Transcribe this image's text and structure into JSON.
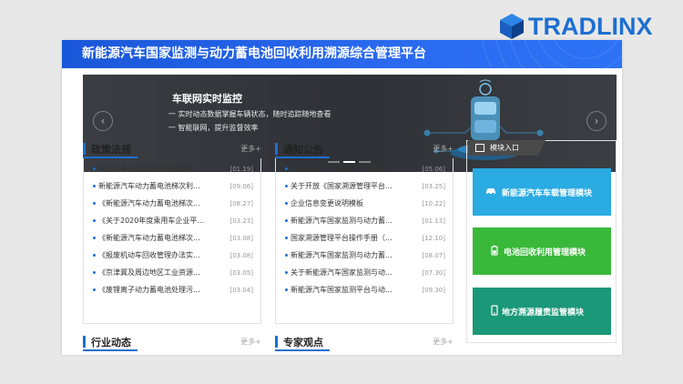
{
  "brand": {
    "name": "TRADLINX",
    "color": "#1d6fd1"
  },
  "header": {
    "title": "新能源汽车国家监测与动力蓄电池回收利用溯源综合管理平台"
  },
  "banner": {
    "title": "车联网实时监控",
    "lines": [
      "一 实时动态数据掌握车辆状态，随时追踪随地查看",
      "一 智能联网，提升监督效率"
    ],
    "prev_icon": "chevron-left-icon",
    "next_icon": "chevron-right-icon"
  },
  "policy": {
    "title": "政策法规",
    "more": "更多+",
    "items": [
      {
        "text": "关于完善资源综合利用增值税...",
        "date": "[01.19]"
      },
      {
        "text": "新能源汽车动力蓄电池梯次利...",
        "date": "[09.06]"
      },
      {
        "text": "《新能源汽车动力蓄电池梯次...",
        "date": "[08.27]"
      },
      {
        "text": "《关于2020年度乘用车企业平...",
        "date": "[03.23]"
      },
      {
        "text": "《新能源汽车动力蓄电池梯次...",
        "date": "[03.08]"
      },
      {
        "text": "《报废机动车回收管理办法实...",
        "date": "[03.08]"
      },
      {
        "text": "《京津冀及周边地区工业资源...",
        "date": "[03.05]"
      },
      {
        "text": "《废锂离子动力蓄电池处理污...",
        "date": "[03.04]"
      }
    ]
  },
  "notice": {
    "title": "通知公告",
    "more": "更多+",
    "items": [
      {
        "text": "新能源汽车国家监测与动力蓄...",
        "date": "[05.06]"
      },
      {
        "text": "关于开放《国家溯源管理平台...",
        "date": "[03.25]"
      },
      {
        "text": "企业信息变更说明模板",
        "date": "[10.22]"
      },
      {
        "text": "新能源汽车国家监测与动力蓄...",
        "date": "[01.13]"
      },
      {
        "text": "国家溯源管理平台操作手册（...",
        "date": "[12.10]"
      },
      {
        "text": "新能源汽车国家监测与动力蓄...",
        "date": "[08.07]"
      },
      {
        "text": "关于新能源汽车国家监测与动...",
        "date": "[07.30]"
      },
      {
        "text": "新能源汽车国家监测平台与动...",
        "date": "[09.30]"
      }
    ]
  },
  "industry": {
    "title": "行业动态",
    "more": "更多+"
  },
  "experts": {
    "title": "专家观点",
    "more": "更多+"
  },
  "modules": {
    "tab_label": "模块入口",
    "buttons": [
      {
        "label": "新能源汽车车载管理模块",
        "icon": "car-icon",
        "color": "#2aabe2"
      },
      {
        "label": "电池回收利用管理模块",
        "icon": "battery-icon",
        "color": "#3ab83a"
      },
      {
        "label": "地方溯源履责监管模块",
        "icon": "phone-icon",
        "color": "#1a9878"
      }
    ]
  }
}
